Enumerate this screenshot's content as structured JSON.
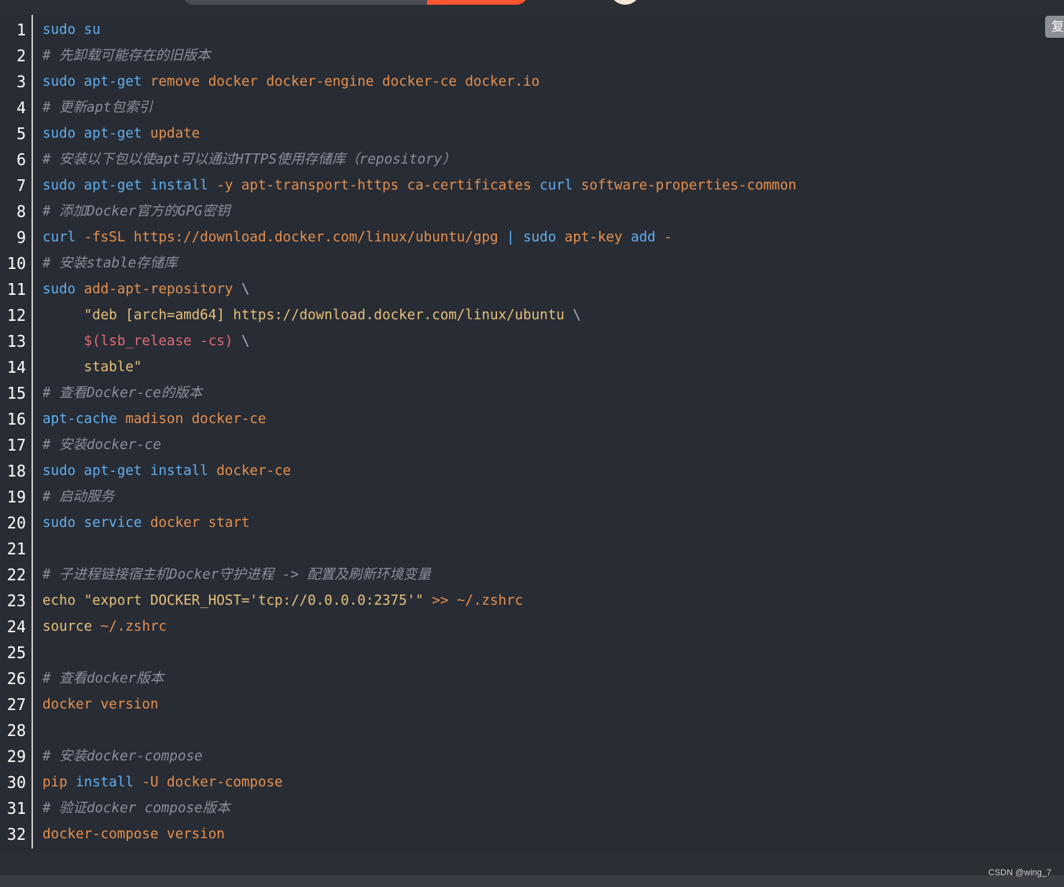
{
  "copy_button_label": "复",
  "watermark": "CSDN @wing_7",
  "lines": [
    {
      "n": "1",
      "tokens": [
        {
          "t": "sudo su",
          "c": "cmd"
        }
      ]
    },
    {
      "n": "2",
      "tokens": [
        {
          "t": "# 先卸载可能存在的旧版本",
          "c": "com"
        }
      ]
    },
    {
      "n": "3",
      "tokens": [
        {
          "t": "sudo apt-get ",
          "c": "cmd"
        },
        {
          "t": "remove docker docker-engine docker-ce docker.io",
          "c": "arg"
        }
      ]
    },
    {
      "n": "4",
      "tokens": [
        {
          "t": "# 更新apt包索引",
          "c": "com"
        }
      ]
    },
    {
      "n": "5",
      "tokens": [
        {
          "t": "sudo apt-get ",
          "c": "cmd"
        },
        {
          "t": "update",
          "c": "arg"
        }
      ]
    },
    {
      "n": "6",
      "tokens": [
        {
          "t": "# 安装以下包以使apt可以通过HTTPS使用存储库（repository）",
          "c": "com"
        }
      ]
    },
    {
      "n": "7",
      "tokens": [
        {
          "t": "sudo apt-get install ",
          "c": "cmd"
        },
        {
          "t": "-y apt-transport-https ca-certificates ",
          "c": "arg"
        },
        {
          "t": "curl ",
          "c": "cmd"
        },
        {
          "t": "software-properties-common",
          "c": "arg"
        }
      ]
    },
    {
      "n": "8",
      "tokens": [
        {
          "t": "# 添加Docker官方的GPG密钥",
          "c": "com"
        }
      ]
    },
    {
      "n": "9",
      "tokens": [
        {
          "t": "curl ",
          "c": "cmd"
        },
        {
          "t": "-fsSL https://download.docker.com/linux/ubuntu/gpg ",
          "c": "arg"
        },
        {
          "t": "| ",
          "c": "cmd"
        },
        {
          "t": "sudo ",
          "c": "cmd"
        },
        {
          "t": "apt-key ",
          "c": "arg"
        },
        {
          "t": "add ",
          "c": "cmd"
        },
        {
          "t": "-",
          "c": "arg"
        }
      ]
    },
    {
      "n": "10",
      "tokens": [
        {
          "t": "# 安装stable存储库",
          "c": "com"
        }
      ]
    },
    {
      "n": "11",
      "tokens": [
        {
          "t": "sudo ",
          "c": "cmd"
        },
        {
          "t": "add-apt-repository ",
          "c": "arg"
        },
        {
          "t": "\\",
          "c": "pln"
        }
      ]
    },
    {
      "n": "12",
      "tokens": [
        {
          "t": "     \"deb [arch=amd64] https://download.docker.com/linux/ubuntu ",
          "c": "yel"
        },
        {
          "t": "\\",
          "c": "pln"
        }
      ]
    },
    {
      "n": "13",
      "tokens": [
        {
          "t": "     $(lsb_release -cs) ",
          "c": "var"
        },
        {
          "t": "\\",
          "c": "pln"
        }
      ]
    },
    {
      "n": "14",
      "tokens": [
        {
          "t": "     stable\"",
          "c": "yel"
        }
      ]
    },
    {
      "n": "15",
      "tokens": [
        {
          "t": "# 查看Docker-ce的版本",
          "c": "com"
        }
      ]
    },
    {
      "n": "16",
      "tokens": [
        {
          "t": "apt-cache ",
          "c": "cmd"
        },
        {
          "t": "madison docker-ce",
          "c": "arg"
        }
      ]
    },
    {
      "n": "17",
      "tokens": [
        {
          "t": "# 安装docker-ce",
          "c": "com"
        }
      ]
    },
    {
      "n": "18",
      "tokens": [
        {
          "t": "sudo apt-get install ",
          "c": "cmd"
        },
        {
          "t": "docker-ce",
          "c": "arg"
        }
      ]
    },
    {
      "n": "19",
      "tokens": [
        {
          "t": "# 启动服务",
          "c": "com"
        }
      ]
    },
    {
      "n": "20",
      "tokens": [
        {
          "t": "sudo service ",
          "c": "cmd"
        },
        {
          "t": "docker start",
          "c": "arg"
        }
      ]
    },
    {
      "n": "21",
      "tokens": []
    },
    {
      "n": "22",
      "tokens": [
        {
          "t": "# 子进程链接宿主机Docker守护进程 -> 配置及刷新环境变量",
          "c": "com"
        }
      ]
    },
    {
      "n": "23",
      "tokens": [
        {
          "t": "echo ",
          "c": "yel"
        },
        {
          "t": "\"export DOCKER_HOST='tcp://0.0.0.0:2375'\" ",
          "c": "yel"
        },
        {
          "t": ">> ~/.zshrc",
          "c": "arg"
        }
      ]
    },
    {
      "n": "24",
      "tokens": [
        {
          "t": "source ",
          "c": "yel"
        },
        {
          "t": "~/.zshrc",
          "c": "arg"
        }
      ]
    },
    {
      "n": "25",
      "tokens": []
    },
    {
      "n": "26",
      "tokens": [
        {
          "t": "# 查看docker版本",
          "c": "com"
        }
      ]
    },
    {
      "n": "27",
      "tokens": [
        {
          "t": "docker version",
          "c": "arg"
        }
      ]
    },
    {
      "n": "28",
      "tokens": []
    },
    {
      "n": "29",
      "tokens": [
        {
          "t": "# 安装docker-compose",
          "c": "com"
        }
      ]
    },
    {
      "n": "30",
      "tokens": [
        {
          "t": "pip ",
          "c": "arg"
        },
        {
          "t": "install ",
          "c": "cmd"
        },
        {
          "t": "-U docker-compose",
          "c": "arg"
        }
      ]
    },
    {
      "n": "31",
      "tokens": [
        {
          "t": "# 验证docker compose版本",
          "c": "com"
        }
      ]
    },
    {
      "n": "32",
      "tokens": [
        {
          "t": "docker-compose version",
          "c": "arg"
        }
      ]
    }
  ]
}
